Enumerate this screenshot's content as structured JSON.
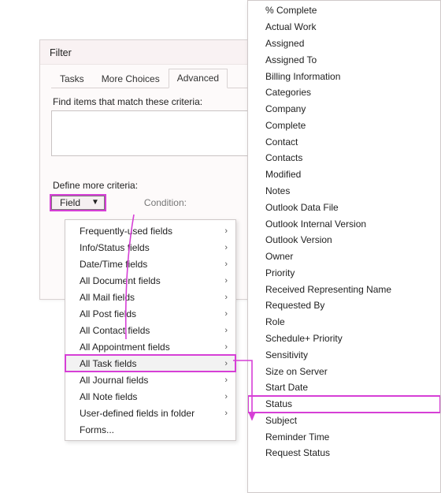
{
  "dialog": {
    "title": "Filter",
    "tabs": [
      {
        "label": "Tasks"
      },
      {
        "label": "More Choices"
      },
      {
        "label": "Advanced"
      }
    ],
    "active_tab_index": 2,
    "criteria_label": "Find items that match these criteria:",
    "define_label": "Define more criteria:",
    "field_button": "Field",
    "condition_label": "Condition:"
  },
  "field_menu": [
    {
      "label": "Frequently-used fields",
      "has_sub": true
    },
    {
      "label": "Info/Status fields",
      "has_sub": true
    },
    {
      "label": "Date/Time fields",
      "has_sub": true
    },
    {
      "label": "All Document fields",
      "has_sub": true
    },
    {
      "label": "All Mail fields",
      "has_sub": true
    },
    {
      "label": "All Post fields",
      "has_sub": true
    },
    {
      "label": "All Contact fields",
      "has_sub": true
    },
    {
      "label": "All Appointment fields",
      "has_sub": true
    },
    {
      "label": "All Task fields",
      "has_sub": true
    },
    {
      "label": "All Journal fields",
      "has_sub": true
    },
    {
      "label": "All Note fields",
      "has_sub": true
    },
    {
      "label": "User-defined fields in folder",
      "has_sub": true
    },
    {
      "label": "Forms...",
      "has_sub": false
    }
  ],
  "field_menu_hovered_index": 8,
  "field_menu_highlight_index": 8,
  "task_submenu": [
    "% Complete",
    "Actual Work",
    "Assigned",
    "Assigned To",
    "Billing Information",
    "Categories",
    "Company",
    "Complete",
    "Contact",
    "Contacts",
    "Modified",
    "Notes",
    "Outlook Data File",
    "Outlook Internal Version",
    "Outlook Version",
    "Owner",
    "Priority",
    "Received Representing Name",
    "Requested By",
    "Role",
    "Schedule+ Priority",
    "Sensitivity",
    "Size on Server",
    "Start Date",
    "Status",
    "Subject",
    "Reminder Time",
    "Request Status"
  ],
  "task_submenu_highlight_index": 24,
  "annotation": {
    "color": "#d63fd6"
  }
}
